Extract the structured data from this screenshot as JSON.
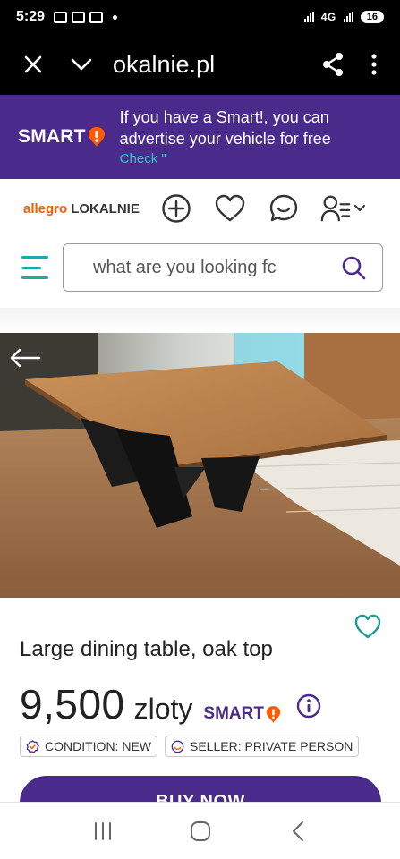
{
  "status_bar": {
    "time": "5:29",
    "network": "4G",
    "battery": "16"
  },
  "browser": {
    "url": "okalnie.pl"
  },
  "promo": {
    "logo_text": "SMART",
    "line1": "If you have a Smart!, you can",
    "line2": "advertise your vehicle for free",
    "link": "Check \""
  },
  "header": {
    "brand_part1": "allegro",
    "brand_part2": "LOKALNIE"
  },
  "search": {
    "placeholder": "what are you looking fc"
  },
  "product": {
    "title": "Large dining table, oak top",
    "price": "9,500",
    "currency": "zloty",
    "smart_label": "SMART",
    "tags": [
      {
        "label": "CONDITION: NEW",
        "icon": "condition-badge-icon"
      },
      {
        "label": "SELLER: PRIVATE PERSON",
        "icon": "seller-smile-icon"
      }
    ],
    "buy_label": "BUY NOW"
  },
  "colors": {
    "brand_purple": "#4a2a8b",
    "teal": "#20a8a6",
    "orange": "#ff5a00"
  }
}
